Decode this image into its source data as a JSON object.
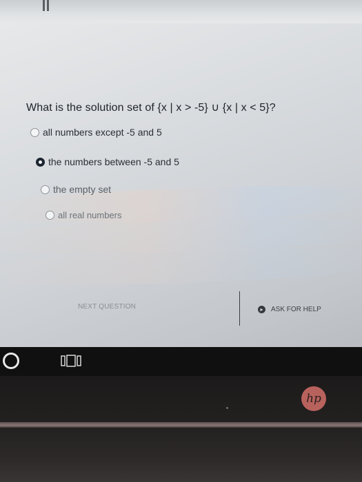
{
  "quiz": {
    "question": "What is the solution set of {x | x > -5} ∪ {x | x < 5}?",
    "options": [
      {
        "label": "all numbers except -5 and 5",
        "selected": false
      },
      {
        "label": "the numbers between -5 and 5",
        "selected": true
      },
      {
        "label": "the empty set",
        "selected": false
      },
      {
        "label": "all real numbers",
        "selected": false
      }
    ],
    "next_label": "NEXT QUESTION",
    "help_label": "ASK FOR HELP",
    "help_icon": "help-arrow-icon"
  },
  "taskbar": {
    "start_icon": "windows-start-icon",
    "taskview_icon": "task-view-icon"
  },
  "device": {
    "brand_logo": "hp",
    "logo_color": "#b8625d"
  }
}
